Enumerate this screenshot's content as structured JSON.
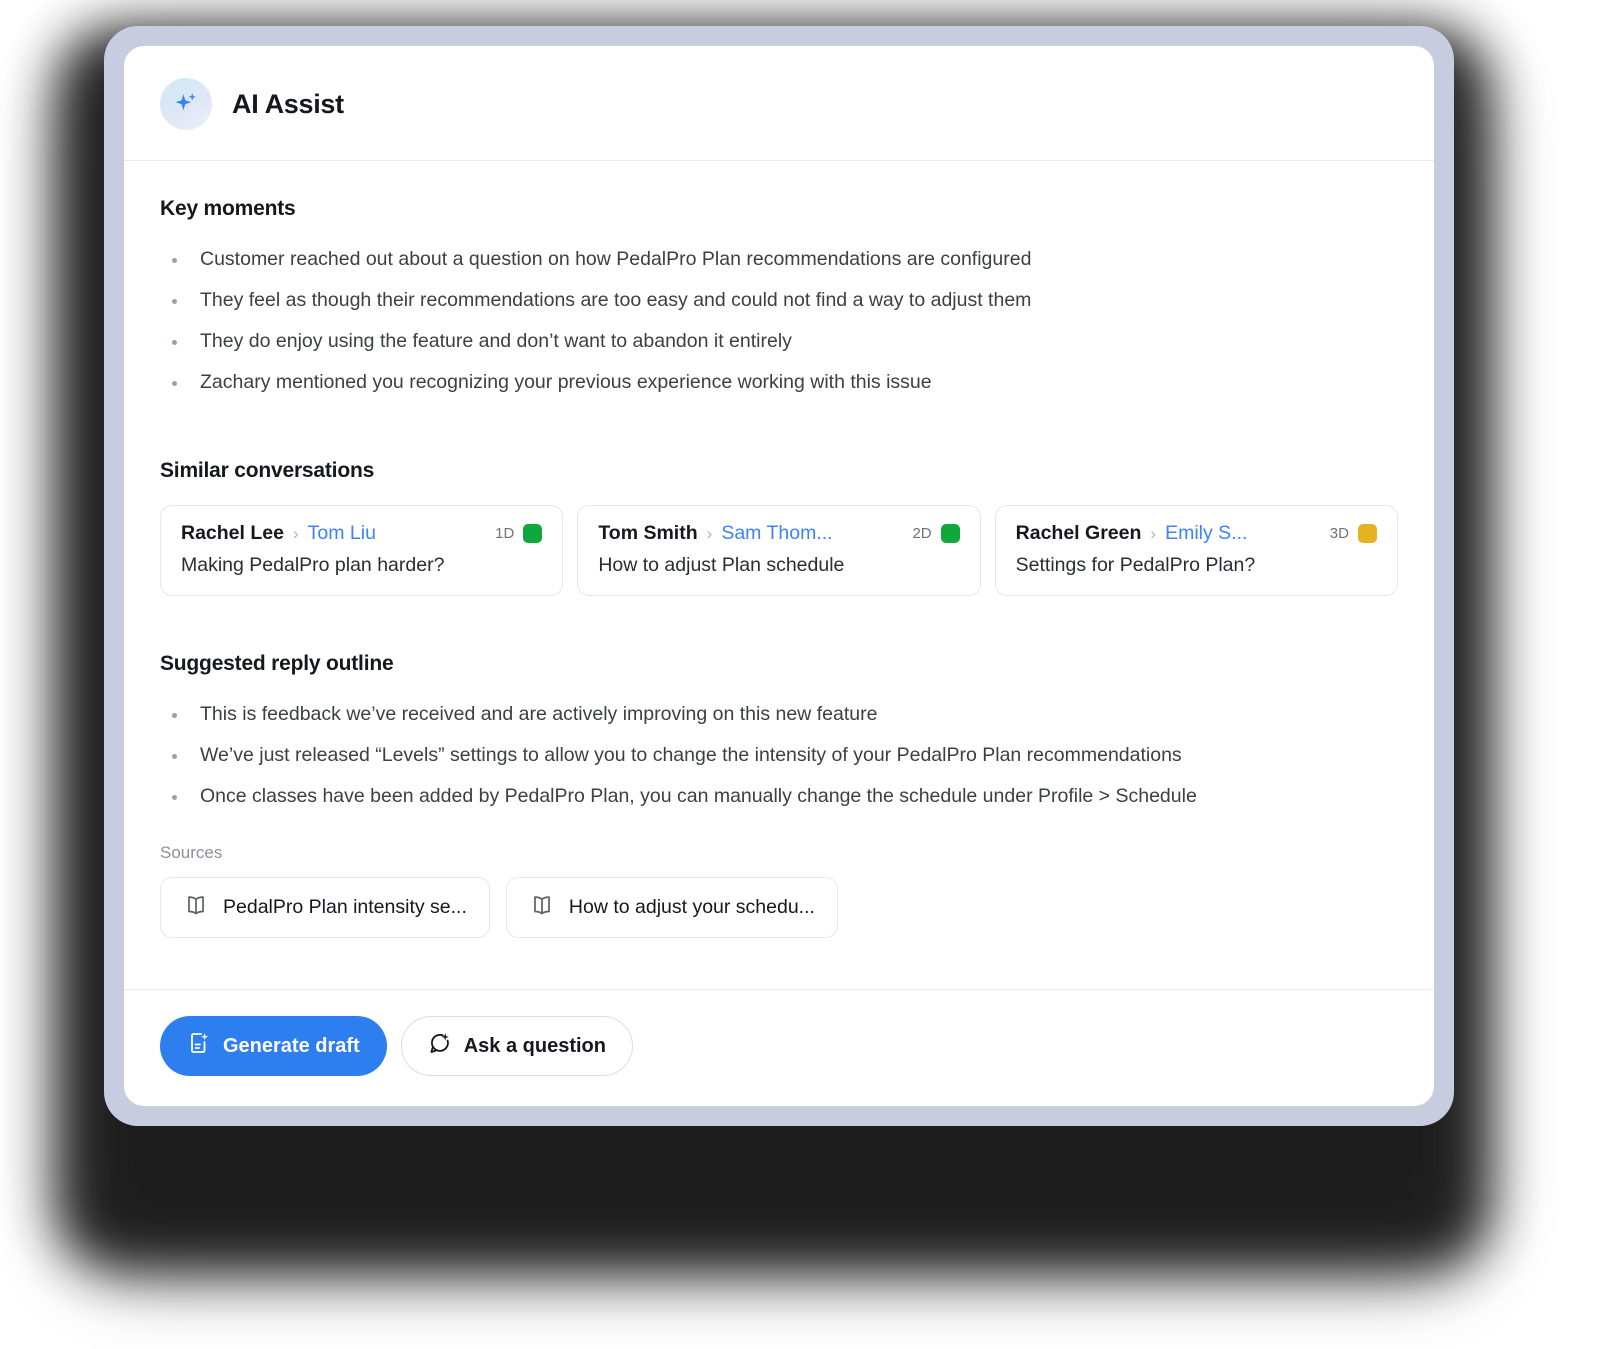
{
  "header": {
    "title": "AI Assist",
    "avatar_icon": "sparkle-icon"
  },
  "key_moments": {
    "heading": "Key moments",
    "items": [
      "Customer reached out about a question on how PedalPro Plan recommendations are configured",
      "They feel as though their recommendations are too easy and could not find a way to adjust them",
      "They do enjoy using the feature and don’t want to abandon it entirely",
      "Zachary mentioned you recognizing your previous experience working with this issue"
    ]
  },
  "similar_conversations": {
    "heading": "Similar conversations",
    "cards": [
      {
        "from": "Rachel Lee",
        "separator": "›",
        "to": "Tom Liu",
        "age": "1D",
        "status_color": "#0fa83c",
        "subject": "Making PedalPro plan harder?"
      },
      {
        "from": "Tom Smith",
        "separator": "›",
        "to": "Sam Thom...",
        "age": "2D",
        "status_color": "#0fa83c",
        "subject": "How to adjust Plan schedule"
      },
      {
        "from": "Rachel Green",
        "separator": "›",
        "to": "Emily S...",
        "age": "3D",
        "status_color": "#e5b320",
        "subject": "Settings for PedalPro Plan?"
      }
    ]
  },
  "suggested_reply": {
    "heading": "Suggested reply outline",
    "items": [
      "This is feedback we’ve received and are actively improving on this new feature",
      "We’ve just released “Levels” settings to allow you to change the intensity of your PedalPro Plan recommendations",
      "Once classes have been added by PedalPro Plan, you can manually change the schedule under Profile > Schedule"
    ]
  },
  "sources": {
    "label": "Sources",
    "chips": [
      {
        "icon": "book-icon",
        "text": "PedalPro Plan intensity se..."
      },
      {
        "icon": "book-icon",
        "text": "How to adjust your schedu..."
      }
    ]
  },
  "footer": {
    "generate_draft_label": "Generate draft",
    "generate_draft_icon": "document-sparkle-icon",
    "ask_question_label": "Ask a question",
    "ask_question_icon": "chat-sparkle-icon",
    "primary_color": "#2d7ff0"
  }
}
